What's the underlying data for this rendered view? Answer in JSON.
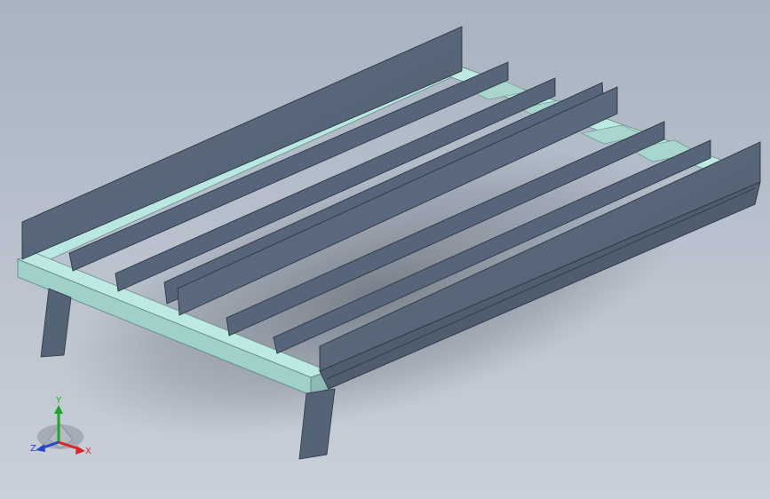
{
  "viewport": {
    "background_top": "#a9b3c1",
    "background_bottom": "#c9d0d9"
  },
  "model": {
    "plank_color": "#59687a",
    "plank_edge_color": "#2d3642",
    "rail_color": "#b7e6e0",
    "rail_side_color": "#a6d6cf",
    "leg_color": "#4e5c6d"
  },
  "triad": {
    "x_label": "X",
    "y_label": "Y",
    "z_label": "Z",
    "x_color": "#d92727",
    "y_color": "#1fa52a",
    "z_color": "#2747c9",
    "icons": [
      "axis-triad-icon"
    ]
  }
}
